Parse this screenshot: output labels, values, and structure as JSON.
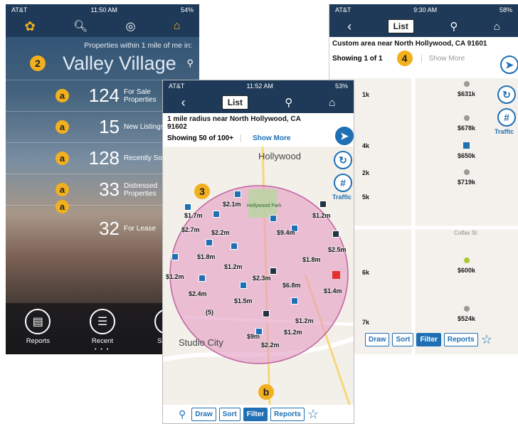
{
  "colors": {
    "nav": "#1e3a58",
    "accent": "#1f6fb5",
    "badge": "#f2b01e",
    "radius": "#e5a2c6"
  },
  "phone1": {
    "status": {
      "carrier": "AT&T",
      "time": "11:50 AM",
      "battery": "54%"
    },
    "header": "Properties within 1 mile of me in:",
    "location": "Valley Village",
    "badge_step": "2",
    "rows": [
      {
        "badge": "a",
        "num": "124",
        "label": "For Sale Properties"
      },
      {
        "badge": "a",
        "num": "15",
        "label": "New Listings"
      },
      {
        "badge": "a",
        "num": "128",
        "label": "Recently Sold"
      },
      {
        "badge": "a",
        "num": "33",
        "label": "Distressed Properties"
      },
      {
        "badge": "a",
        "num": "32",
        "label": "For Lease"
      }
    ],
    "bottom": [
      "Reports",
      "Recent",
      "Saved"
    ]
  },
  "phone2": {
    "status": {
      "carrier": "AT&T",
      "time": "11:52 AM",
      "battery": "53%"
    },
    "nav": {
      "list": "List"
    },
    "title": "1 mile radius near North Hollywood, CA 91602",
    "showing": "Showing 50 of 100+",
    "show_more": "Show More",
    "badge_step": "3",
    "badge_b": "b",
    "map_labels": [
      "Hollywood",
      "Studio City",
      "Hollywood Park"
    ],
    "side_traffic": "Traffic",
    "pins": [
      "$1.7m",
      "$2.1m",
      "$2.7m",
      "$2.2m",
      "$9.4m",
      "$1.2m",
      "$1.8m",
      "$1.2m",
      "$2.5m",
      "$1.8m",
      "$1.2m",
      "$2.4m",
      "$2.3m",
      "$6.8m",
      "$1.4m",
      "$1.5m",
      "$1.2m",
      "$9m",
      "$2.2m",
      "$1.2m",
      "(5)"
    ],
    "toolbar": [
      "Draw",
      "Sort",
      "Filter",
      "Reports"
    ]
  },
  "phone3": {
    "status": {
      "carrier": "AT&T",
      "time": "9:30 AM",
      "battery": "58%"
    },
    "nav": {
      "list": "List"
    },
    "title": "Custom area near North Hollywood, CA 91601",
    "showing": "Showing 1 of 1",
    "show_more": "Show More",
    "badge_step": "4",
    "prices": [
      "$631k",
      "$678k",
      "$650k",
      "$719k",
      "$600k",
      "$524k"
    ],
    "left_prices": [
      "1k",
      "4k",
      "2k",
      "5k",
      "6k",
      "7k"
    ],
    "streets": [
      "Colfax St"
    ],
    "side_traffic": "Traffic",
    "toolbar": [
      "Draw",
      "Sort",
      "Filter",
      "Reports"
    ]
  }
}
